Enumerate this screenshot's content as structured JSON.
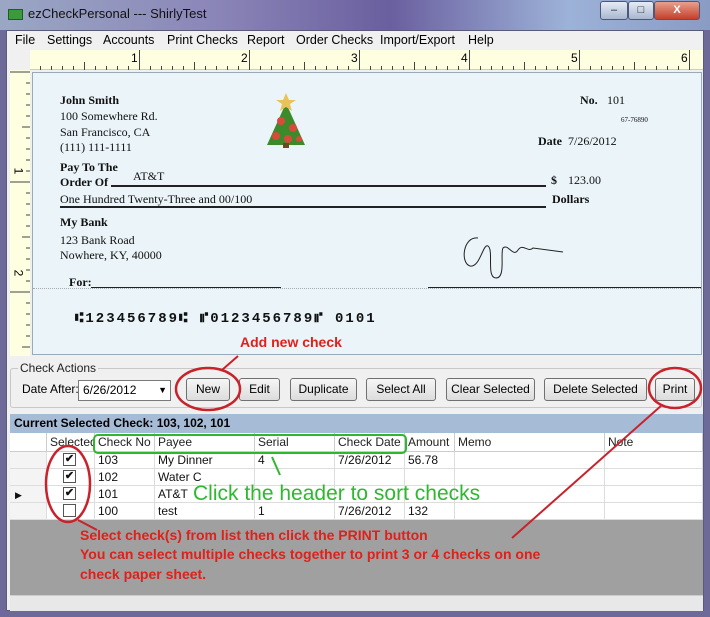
{
  "window": {
    "title": "ezCheckPersonal --- ShirlyTest",
    "minimize": "–",
    "maximize": "□",
    "close": "X"
  },
  "menu": [
    {
      "label": "File"
    },
    {
      "label": "Settings"
    },
    {
      "label": "Accounts"
    },
    {
      "label": "Print Checks"
    },
    {
      "label": "Report"
    },
    {
      "label": "Order Checks"
    },
    {
      "label": "Import/Export"
    },
    {
      "label": "Help"
    }
  ],
  "ruler": {
    "top": [
      "1",
      "2",
      "3",
      "4",
      "5",
      "6"
    ],
    "left": [
      "1",
      "2"
    ]
  },
  "check": {
    "owner_name": "John Smith",
    "owner_address1": "100 Somewhere Rd.",
    "owner_address2": "San Francisco, CA",
    "owner_phone": "(111) 111-1111",
    "no_label": "No.",
    "number": "101",
    "routing_fraction": "67-76890",
    "date_label": "Date",
    "date": "7/26/2012",
    "pay_to_label1": "Pay To The",
    "pay_to_label2": "Order Of",
    "payee": "AT&T",
    "dollar_sign": "$",
    "amount": "123.00",
    "amount_words": "One Hundred Twenty-Three and 00/100",
    "dollars_label": "Dollars",
    "bank_name": "My Bank",
    "bank_address1": "123 Bank Road",
    "bank_address2": "Nowhere, KY, 40000",
    "for_label": "For:",
    "micr": "⑆123456789⑆ ⑈0123456789⑈ 0101",
    "image_icon": "christmas-tree"
  },
  "actions": {
    "legend": "Check Actions",
    "date_after_label": "Date After:",
    "date_after": "6/26/2012",
    "buttons": {
      "new": "New",
      "edit": "Edit",
      "duplicate": "Duplicate",
      "select_all": "Select All",
      "clear_selected": "Clear Selected",
      "delete_selected": "Delete Selected",
      "print": "Print"
    }
  },
  "grid": {
    "title": "Current Selected Check: 103, 102, 101",
    "columns": [
      "Selected",
      "Check No",
      "Payee",
      "Serial Number",
      "Check Date",
      "Amount",
      "Memo",
      "Note"
    ],
    "rows": [
      {
        "selected": true,
        "check_no": "103",
        "payee": "My Dinner",
        "serial": "4",
        "date": "7/26/2012",
        "amount": "56.78",
        "memo": "",
        "note": ""
      },
      {
        "selected": true,
        "check_no": "102",
        "payee": "Water C",
        "serial": "",
        "date": "",
        "amount": "",
        "memo": "",
        "note": ""
      },
      {
        "selected": true,
        "check_no": "101",
        "payee": "AT&T",
        "serial": "",
        "date": "",
        "amount": "",
        "memo": "",
        "note": "",
        "current": true
      },
      {
        "selected": false,
        "check_no": "100",
        "payee": "test",
        "serial": "1",
        "date": "7/26/2012",
        "amount": "132",
        "memo": "",
        "note": ""
      }
    ]
  },
  "annotations": {
    "add_new": "Add new check",
    "sort": "Click the header to sort checks",
    "select_line1": "Select check(s) from list then click the PRINT button",
    "select_line2": "You can select multiple checks together to print 3 or 4 checks on one",
    "select_line3": "check paper sheet.",
    "colors": {
      "red": "#c8222a",
      "green": "#2eb82e"
    }
  }
}
